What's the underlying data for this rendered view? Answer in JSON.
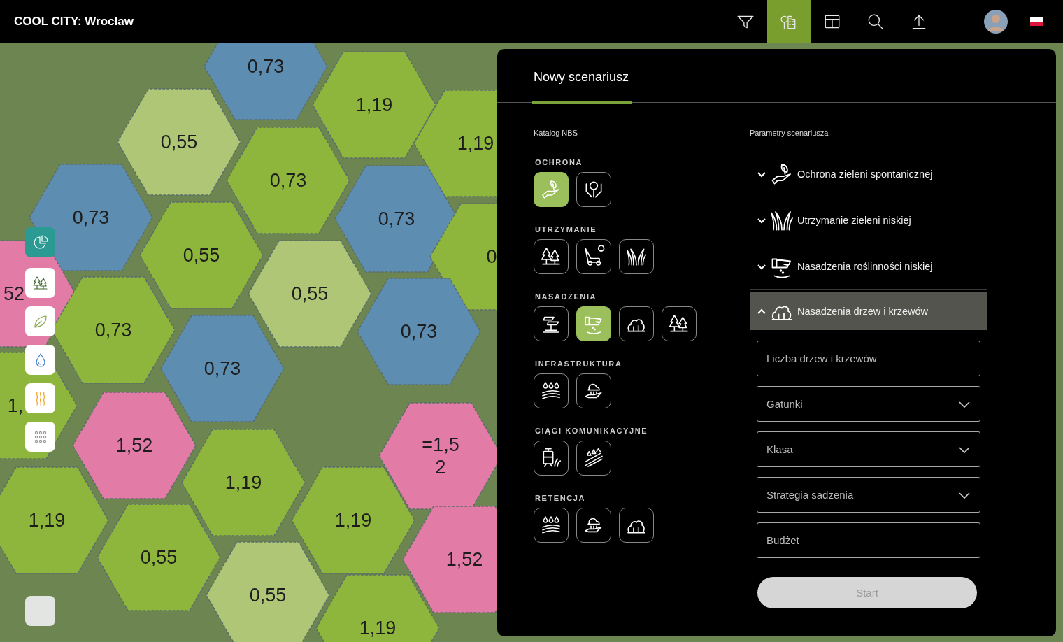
{
  "app_title": "COOL CITY: Wrocław",
  "toolbar": [
    {
      "selected": false
    },
    {
      "selected": true
    },
    {
      "selected": false
    },
    {
      "selected": false
    },
    {
      "selected": false
    }
  ],
  "layers": [
    {
      "selected": true
    },
    {
      "selected": false
    },
    {
      "selected": false
    },
    {
      "selected": false
    },
    {
      "selected": false
    },
    {
      "selected": false
    }
  ],
  "hexes": [
    {
      "value": "0,73",
      "color": "#5e8db2"
    },
    {
      "value": "1,19",
      "color": "#8fb63c"
    },
    {
      "value": "0,55",
      "color": "#b0c677"
    },
    {
      "value": "1,19",
      "color": "#8fb63c"
    },
    {
      "value": "0,73",
      "color": "#8fb63c"
    },
    {
      "value": "0,73",
      "color": "#5e8db2"
    },
    {
      "value": "0,73",
      "color": "#5e8db2"
    },
    {
      "value": "0,55",
      "color": "#8fb63c"
    },
    {
      "value": "0",
      "color": "#8fb63c"
    },
    {
      "value": "52",
      "color": "#e27ba6"
    },
    {
      "value": "0,55",
      "color": "#b0c677"
    },
    {
      "value": "0,73",
      "color": "#8fb63c"
    },
    {
      "value": "0,73",
      "color": "#5e8db2"
    },
    {
      "value": "0,73",
      "color": "#5e8db2"
    },
    {
      "value": "1,",
      "color": "#8fb63c"
    },
    {
      "value": "1,52",
      "color": "#e27ba6"
    },
    {
      "value": "=1,5\n2",
      "color": "#e27ba6"
    },
    {
      "value": "1,19",
      "color": "#8fb63c"
    },
    {
      "value": "1,19",
      "color": "#8fb63c"
    },
    {
      "value": "1,19",
      "color": "#8fb63c"
    },
    {
      "value": "0,55",
      "color": "#8fb63c"
    },
    {
      "value": "1,52",
      "color": "#e27ba6"
    },
    {
      "value": "0,55",
      "color": "#b0c677"
    },
    {
      "value": "1,19",
      "color": "#8fb63c"
    }
  ],
  "panel": {
    "tab": {
      "label": "Nowy scenariusz",
      "selected": true
    },
    "catalog": {
      "title": "Katalog NBS",
      "categories": [
        {
          "name": "OCHRONA",
          "items": [
            {
              "selected": true
            },
            {
              "selected": false
            }
          ]
        },
        {
          "name": "UTRZYMANIE",
          "items": [
            {
              "selected": false
            },
            {
              "selected": false
            },
            {
              "selected": false
            }
          ]
        },
        {
          "name": "NASADZENIA",
          "items": [
            {
              "selected": false
            },
            {
              "selected": true
            },
            {
              "selected": false
            },
            {
              "selected": false
            }
          ]
        },
        {
          "name": "INFRASTRUKTURA",
          "items": [
            {
              "selected": false
            },
            {
              "selected": false
            }
          ]
        },
        {
          "name": "CIĄGI KOMUNIKACYJNE",
          "items": [
            {
              "selected": false
            },
            {
              "selected": false
            }
          ]
        },
        {
          "name": "RETENCJA",
          "items": [
            {
              "selected": false
            },
            {
              "selected": false
            },
            {
              "selected": false
            }
          ]
        }
      ]
    },
    "parameters": {
      "title": "Parametry scenariusza",
      "groups": [
        {
          "label": "Ochrona zieleni spontanicznej",
          "expanded": false
        },
        {
          "label": "Utrzymanie zieleni niskiej",
          "expanded": false
        },
        {
          "label": "Nasadzenia roślinności niskiej",
          "expanded": false
        },
        {
          "label": "Nasadzenia drzew i krzewów",
          "expanded": true
        }
      ],
      "fields": [
        {
          "kind": "text",
          "placeholder": "Liczba drzew i krzewów"
        },
        {
          "kind": "select",
          "placeholder": "Gatunki"
        },
        {
          "kind": "select",
          "placeholder": "Klasa"
        },
        {
          "kind": "select",
          "placeholder": "Strategia sadzenia"
        },
        {
          "kind": "text",
          "placeholder": "Budżet"
        }
      ],
      "start": {
        "label": "Start",
        "disabled": true
      }
    }
  }
}
